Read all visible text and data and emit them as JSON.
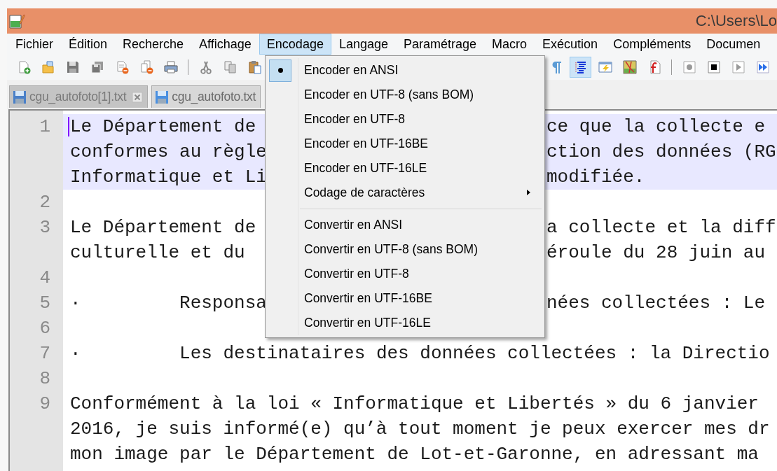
{
  "window": {
    "title": "C:\\Users\\Lo"
  },
  "menu_bar": [
    {
      "label": "Fichier",
      "selected": false
    },
    {
      "label": "Édition",
      "selected": false
    },
    {
      "label": "Recherche",
      "selected": false
    },
    {
      "label": "Affichage",
      "selected": false
    },
    {
      "label": "Encodage",
      "selected": true
    },
    {
      "label": "Langage",
      "selected": false
    },
    {
      "label": "Paramétrage",
      "selected": false
    },
    {
      "label": "Macro",
      "selected": false
    },
    {
      "label": "Exécution",
      "selected": false
    },
    {
      "label": "Compléments",
      "selected": false
    },
    {
      "label": "Documen",
      "selected": false
    }
  ],
  "toolbar_left": [
    {
      "kind": "new"
    },
    {
      "kind": "open"
    },
    {
      "kind": "save"
    },
    {
      "kind": "save-all"
    },
    {
      "kind": "close"
    },
    {
      "kind": "close-all"
    },
    {
      "kind": "print"
    },
    {
      "kind": "separator"
    },
    {
      "kind": "cut"
    },
    {
      "kind": "copy"
    },
    {
      "kind": "paste"
    }
  ],
  "toolbar_right": [
    {
      "kind": "pilcrow",
      "on": false
    },
    {
      "kind": "indent-guide",
      "on": true
    },
    {
      "kind": "panel",
      "on": false
    },
    {
      "kind": "map",
      "on": false
    },
    {
      "kind": "function-doc",
      "on": false
    },
    {
      "kind": "separator"
    },
    {
      "kind": "record",
      "on": false
    },
    {
      "kind": "stop",
      "on": false
    },
    {
      "kind": "play",
      "on": false
    },
    {
      "kind": "fast-forward",
      "on": false
    }
  ],
  "tabs": [
    {
      "label": "cgu_autofoto[1].txt",
      "selected": false,
      "closable": true
    },
    {
      "label": "cgu_autofoto.txt",
      "selected": true,
      "closable": false
    }
  ],
  "editor": {
    "lines": [
      {
        "number": "1",
        "current": true,
        "rows": [
          {
            "kind": "split",
            "left": "Le Département de",
            "right": "ce que la collecte e"
          },
          {
            "kind": "split",
            "left": "conformes au règle",
            "right": "ction des données (RG"
          },
          {
            "kind": "split",
            "left": "Informatique et Li",
            "right": "modifiée."
          }
        ]
      },
      {
        "number": "2",
        "current": false
      },
      {
        "number": "3",
        "current": false,
        "rows": [
          {
            "kind": "split",
            "left": "Le Département de",
            "right": "a collecte et la diff"
          },
          {
            "kind": "split",
            "left": "culturelle et du",
            "right": "éroule du 28 juin au"
          }
        ]
      },
      {
        "number": "4",
        "current": false
      },
      {
        "number": "5",
        "current": false,
        "rows": [
          {
            "kind": "split",
            "left": "·\tResponsa",
            "right": "nées collectées : Le"
          }
        ]
      },
      {
        "number": "6",
        "current": false
      },
      {
        "number": "7",
        "current": false,
        "rows": [
          {
            "kind": "full",
            "text": "·\tLes destinataires des données collectées : la Directio"
          }
        ]
      },
      {
        "number": "8",
        "current": false
      },
      {
        "number": "9",
        "current": false,
        "rows": [
          {
            "kind": "full",
            "text": "Conformément à la loi « Informatique et Libertés » du 6 janvier"
          },
          {
            "kind": "full",
            "text": "2016, je suis informé(e) qu’à tout moment je peux exercer mes dr"
          },
          {
            "kind": "full",
            "text": "mon image par le Département de Lot-et-Garonne, en adressant ma"
          }
        ]
      }
    ]
  },
  "dropdown": {
    "items": [
      {
        "kind": "item",
        "label": "Encoder en ANSI",
        "checked": true
      },
      {
        "kind": "item",
        "label": "Encoder en UTF-8 (sans BOM)",
        "checked": false
      },
      {
        "kind": "item",
        "label": "Encoder en UTF-8",
        "checked": false
      },
      {
        "kind": "item",
        "label": "Encoder en UTF-16BE",
        "checked": false
      },
      {
        "kind": "item",
        "label": "Encoder en UTF-16LE",
        "checked": false
      },
      {
        "kind": "submenu",
        "label": "Codage de caractères",
        "checked": false
      },
      {
        "kind": "separator"
      },
      {
        "kind": "item",
        "label": "Convertir en ANSI",
        "checked": false
      },
      {
        "kind": "item",
        "label": "Convertir en UTF-8 (sans BOM)",
        "checked": false
      },
      {
        "kind": "item",
        "label": "Convertir en UTF-8",
        "checked": false
      },
      {
        "kind": "item",
        "label": "Convertir en UTF-16BE",
        "checked": false
      },
      {
        "kind": "item",
        "label": "Convertir en UTF-16LE",
        "checked": false
      }
    ]
  }
}
